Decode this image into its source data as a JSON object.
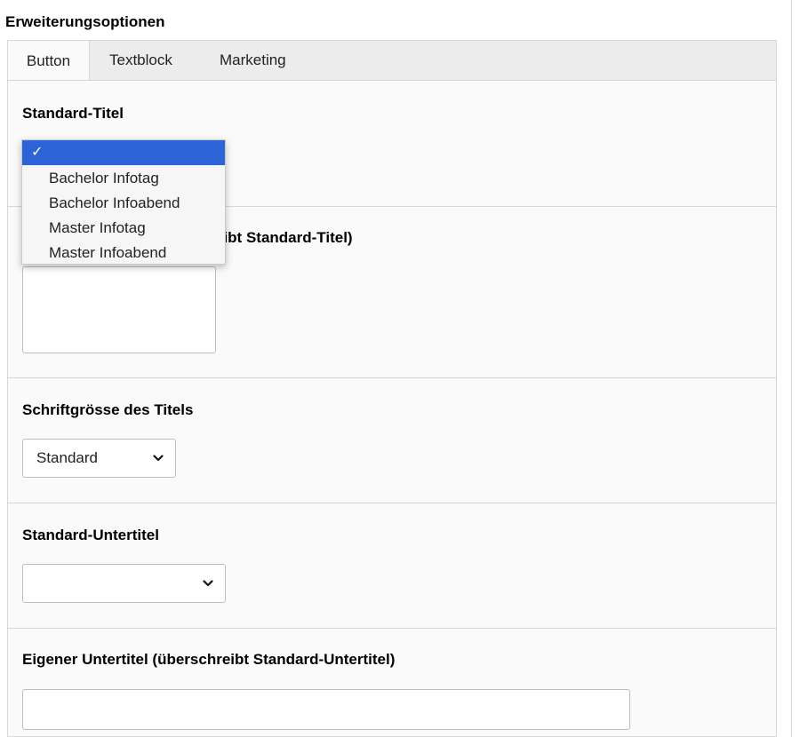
{
  "section_title": "Erweiterungsoptionen",
  "tabs": [
    {
      "label": "Button",
      "active": true
    },
    {
      "label": "Textblock",
      "active": false
    },
    {
      "label": "Marketing",
      "active": false
    }
  ],
  "fields": {
    "standard_title": {
      "label": "Standard-Titel",
      "value": "",
      "options": [
        "",
        "Bachelor Infotag",
        "Bachelor Infoabend",
        "Master Infotag",
        "Master Infoabend"
      ],
      "check_mark": "✓"
    },
    "custom_title": {
      "label_visible_part": "eibt Standard-Titel)",
      "value": ""
    },
    "title_font_size": {
      "label": "Schriftgrösse des Titels",
      "value": "Standard"
    },
    "standard_subtitle": {
      "label": "Standard-Untertitel",
      "value": ""
    },
    "custom_subtitle": {
      "label": "Eigener Untertitel (überschreibt Standard-Untertitel)",
      "value": ""
    }
  },
  "colors": {
    "selection_blue": "#2c63d6",
    "panel_bg": "#fafafa",
    "tabbar_bg": "#ececec",
    "border": "#d7d7d7"
  },
  "icons": {
    "select_arrow": "chevron-down-icon",
    "selected_marker": "checkmark-icon"
  }
}
